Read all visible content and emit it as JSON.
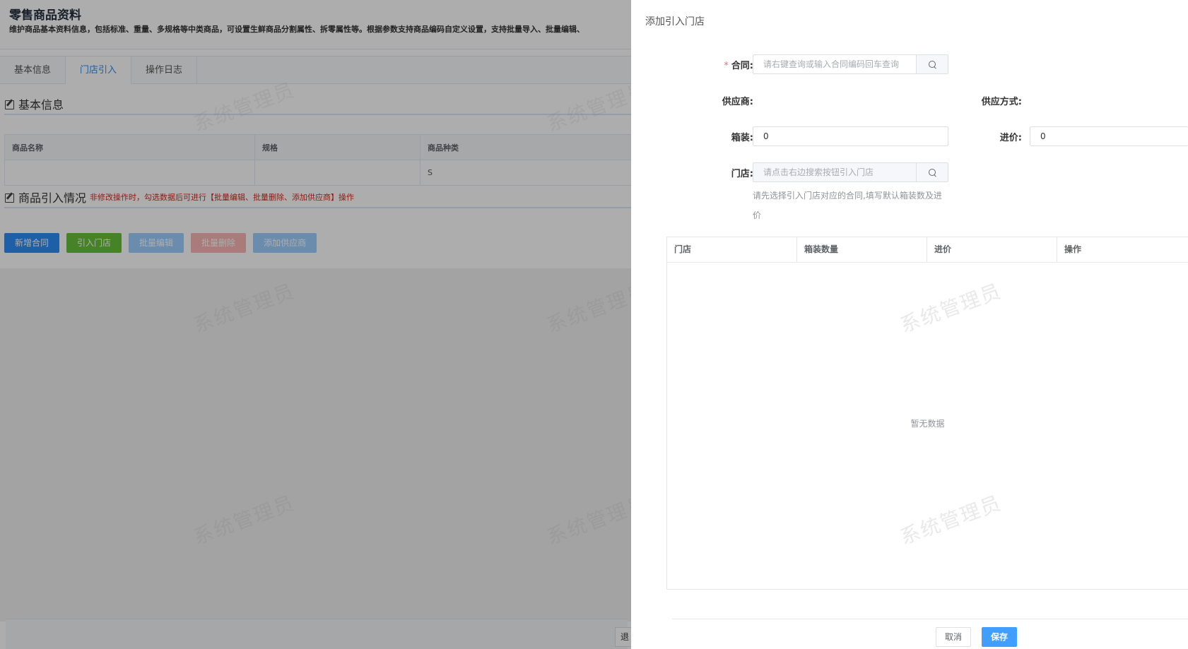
{
  "page": {
    "title": "零售商品资料",
    "description": "维护商品基本资料信息，包括标准、重量、多规格等中类商品，可设置生鲜商品分割属性、拆零属性等。根据参数支持商品编码自定义设置，支持批量导入、批量编辑、"
  },
  "tabs": [
    {
      "label": "基本信息"
    },
    {
      "label": "门店引入"
    },
    {
      "label": "操作日志"
    }
  ],
  "basic_section": {
    "title": "基本信息",
    "columns": [
      "商品名称",
      "规格",
      "商品种类"
    ],
    "row": [
      "",
      "",
      "S"
    ]
  },
  "import_section": {
    "title": "商品引入情况",
    "note": "非修改操作时，勾选数据后可进行【批量编辑、批量删除、添加供应商】操作"
  },
  "buttons": {
    "add_contract": "新增合同",
    "import_store": "引入门店",
    "batch_edit": "批量编辑",
    "batch_delete": "批量删除",
    "add_supplier": "添加供应商"
  },
  "bg_footer": {
    "partial_button": "退"
  },
  "watermark": "系统管理员",
  "drawer": {
    "title": "添加引入门店",
    "contract": {
      "label": "合同:",
      "placeholder": "请右键查询或输入合同编码回车查询"
    },
    "supplier": {
      "label": "供应商:",
      "value": ""
    },
    "supply_mode": {
      "label": "供应方式:",
      "value": ""
    },
    "box": {
      "label": "箱装:",
      "value": "0"
    },
    "price": {
      "label": "进价:",
      "value": "0"
    },
    "store": {
      "label": "门店:",
      "placeholder": "请点击右边搜索按钮引入门店"
    },
    "hint": "请先选择引入门店对应的合同,填写默认箱装数及进价",
    "table": {
      "columns": [
        "门店",
        "箱装数量",
        "进价",
        "操作"
      ],
      "empty": "暂无数据"
    },
    "cancel": "取消",
    "save": "保存"
  }
}
